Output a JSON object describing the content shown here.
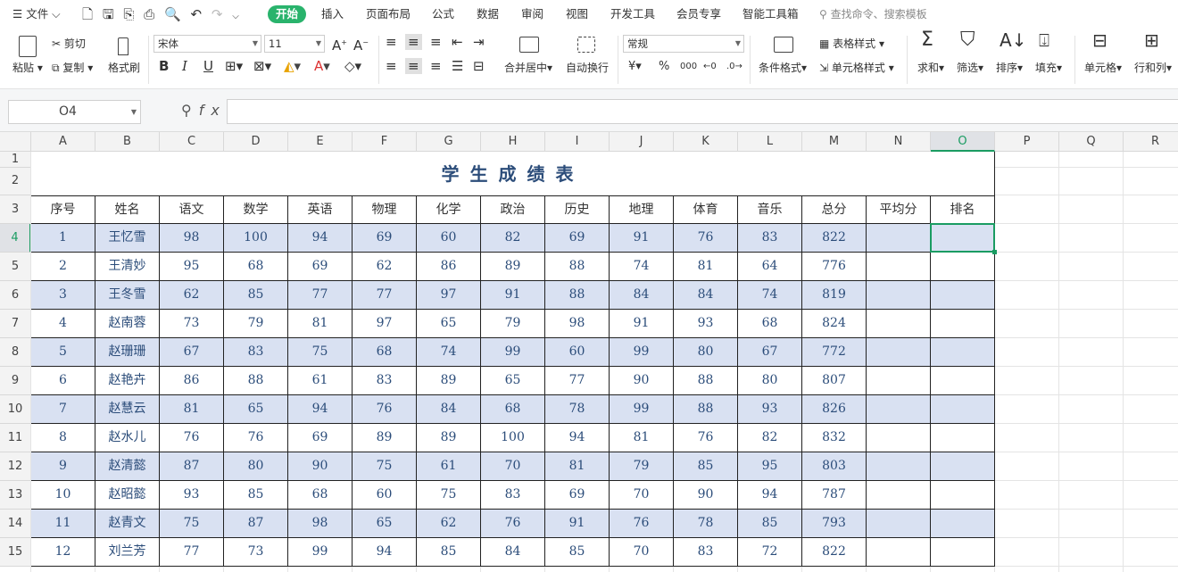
{
  "menubar": {
    "file_menu": "文件",
    "tabs": [
      "开始",
      "插入",
      "页面布局",
      "公式",
      "数据",
      "审阅",
      "视图",
      "开发工具",
      "会员专享",
      "智能工具箱"
    ],
    "active_tab": "开始",
    "search_placeholder": "查找命令、搜索模板"
  },
  "ribbon": {
    "paste": "粘贴",
    "cut": "剪切",
    "copy": "复制",
    "format_painter": "格式刷",
    "font_name": "宋体",
    "font_size": "11",
    "merge_center": "合并居中",
    "wrap_text": "自动换行",
    "number_format": "常规",
    "conditional_format": "条件格式",
    "table_style": "表格样式",
    "cell_style": "单元格样式",
    "sum": "求和",
    "filter": "筛选",
    "sort": "排序",
    "fill": "填充",
    "cell": "单元格",
    "row_col": "行和列"
  },
  "formula_bar": {
    "name_box": "O4",
    "formula": ""
  },
  "sheet": {
    "column_letters": [
      "A",
      "B",
      "C",
      "D",
      "E",
      "F",
      "G",
      "H",
      "I",
      "J",
      "K",
      "L",
      "M",
      "N",
      "O",
      "P",
      "Q",
      "R"
    ],
    "selected_column": "O",
    "row_numbers": [
      "1",
      "2",
      "3",
      "4",
      "5",
      "6",
      "7",
      "8",
      "9",
      "10",
      "11",
      "12",
      "13",
      "14",
      "15"
    ],
    "selected_row": "4",
    "title": "学生成绩表",
    "headers": [
      "序号",
      "姓名",
      "语文",
      "数学",
      "英语",
      "物理",
      "化学",
      "政治",
      "历史",
      "地理",
      "体育",
      "音乐",
      "总分",
      "平均分",
      "排名"
    ],
    "rows": [
      [
        "1",
        "王忆雪",
        "98",
        "100",
        "94",
        "69",
        "60",
        "82",
        "69",
        "91",
        "76",
        "83",
        "822",
        "",
        ""
      ],
      [
        "2",
        "王清妙",
        "95",
        "68",
        "69",
        "62",
        "86",
        "89",
        "88",
        "74",
        "81",
        "64",
        "776",
        "",
        ""
      ],
      [
        "3",
        "王冬雪",
        "62",
        "85",
        "77",
        "77",
        "97",
        "91",
        "88",
        "84",
        "84",
        "74",
        "819",
        "",
        ""
      ],
      [
        "4",
        "赵南蓉",
        "73",
        "79",
        "81",
        "97",
        "65",
        "79",
        "98",
        "91",
        "93",
        "68",
        "824",
        "",
        ""
      ],
      [
        "5",
        "赵珊珊",
        "67",
        "83",
        "75",
        "68",
        "74",
        "99",
        "60",
        "99",
        "80",
        "67",
        "772",
        "",
        ""
      ],
      [
        "6",
        "赵艳卉",
        "86",
        "88",
        "61",
        "83",
        "89",
        "65",
        "77",
        "90",
        "88",
        "80",
        "807",
        "",
        ""
      ],
      [
        "7",
        "赵慧云",
        "81",
        "65",
        "94",
        "76",
        "84",
        "68",
        "78",
        "99",
        "88",
        "93",
        "826",
        "",
        ""
      ],
      [
        "8",
        "赵水儿",
        "76",
        "76",
        "69",
        "89",
        "89",
        "100",
        "94",
        "81",
        "76",
        "82",
        "832",
        "",
        ""
      ],
      [
        "9",
        "赵清懿",
        "87",
        "80",
        "90",
        "75",
        "61",
        "70",
        "81",
        "79",
        "85",
        "95",
        "803",
        "",
        ""
      ],
      [
        "10",
        "赵昭懿",
        "93",
        "85",
        "68",
        "60",
        "75",
        "83",
        "69",
        "70",
        "90",
        "94",
        "787",
        "",
        ""
      ],
      [
        "11",
        "赵青文",
        "75",
        "87",
        "98",
        "65",
        "62",
        "76",
        "91",
        "76",
        "78",
        "85",
        "793",
        "",
        ""
      ],
      [
        "12",
        "刘兰芳",
        "77",
        "73",
        "99",
        "94",
        "85",
        "84",
        "85",
        "70",
        "83",
        "72",
        "822",
        "",
        ""
      ]
    ]
  },
  "colors": {
    "accent_green": "#29b36c",
    "selection_green": "#1a9c62",
    "alt_row_fill": "#d9e1f2",
    "data_text": "#2c4d7a"
  }
}
